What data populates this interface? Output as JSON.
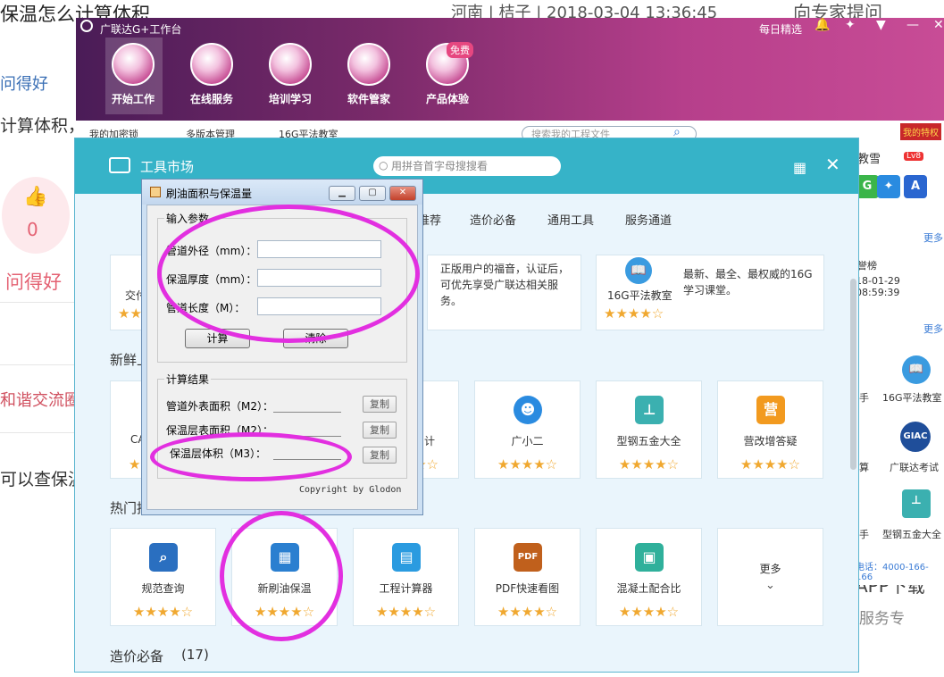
{
  "forum": {
    "title": "保温怎么计算体积",
    "meta": "河南 | 桔子 | 2018-03-04 13:36:45",
    "ask_expert": "向专家提问",
    "good_question_1": "问得好",
    "calc_volume": "计算体积，",
    "like_count": "0",
    "good_question_2": "问得好",
    "harmony_link": "和谐交流圈",
    "can_query": "可以查保温",
    "app_download": "APP下载",
    "service": "服务专"
  },
  "workbench": {
    "title": "广联达G+工作台",
    "daily_pick": "每日精选",
    "nav": [
      {
        "label": "开始工作"
      },
      {
        "label": "在线服务"
      },
      {
        "label": "培训学习"
      },
      {
        "label": "软件管家"
      },
      {
        "label": "产品体验"
      }
    ],
    "free_badge": "免费",
    "search_placeholder": "搜索我的工程文件",
    "quick_links": [
      "我的加密锁",
      "多版本管理",
      "16G平法教室"
    ]
  },
  "side": {
    "tag": "我的特权",
    "user": "教雪",
    "level": "Lv8",
    "more": "更多",
    "rank": "誉榜",
    "rank_time": "18-01-29 08:59:39",
    "items": [
      "手",
      "16G平法教室",
      "算",
      "广联达考试",
      "手",
      "型钢五金大全"
    ],
    "phone": "电话：4000-166-166"
  },
  "market": {
    "title": "工具市场",
    "search_placeholder": "用拼音首字母搜搜看",
    "tabs": [
      "推荐",
      "造价必备",
      "通用工具",
      "服务通道"
    ],
    "top_cards": [
      {
        "name": "交付",
        "desc": ""
      },
      {
        "name": "",
        "desc": "正版用户的福音，认证后，可优先享受广联达相关服务。"
      },
      {
        "name": "16G平法教室",
        "desc": "最新、最全、最权威的16G学习课堂。"
      }
    ],
    "fresh_title": "新鲜上架",
    "fresh_cards": [
      {
        "name": "CA",
        "rating": "★★★★☆"
      },
      {
        "name": "计",
        "rating": "★★★★☆"
      },
      {
        "name": "广小二",
        "rating": "★★★★☆"
      },
      {
        "name": "型钢五金大全",
        "rating": "★★★★☆"
      },
      {
        "name": "营改增答疑",
        "rating": "★★★★☆"
      }
    ],
    "hot_title": "热门推荐",
    "hot_cards": [
      {
        "name": "规范查询",
        "rating": "★★★★☆"
      },
      {
        "name": "新刷油保温",
        "rating": "★★★★☆"
      },
      {
        "name": "工程计算器",
        "rating": "★★★★☆"
      },
      {
        "name": "PDF快速看图",
        "rating": "★★★★☆"
      },
      {
        "name": "混凝土配合比",
        "rating": "★★★★☆"
      }
    ],
    "more": "更多",
    "cost_title": "造价必备",
    "cost_count": "(17)"
  },
  "dialog": {
    "title": "刷油面积与保温量",
    "input_group": "输入参数",
    "fields": [
      {
        "label": "管道外径（mm）：",
        "value": ""
      },
      {
        "label": "保温厚度（mm）：",
        "value": ""
      },
      {
        "label": "管道长度（M）：",
        "value": ""
      }
    ],
    "calc_button": "计算",
    "clear_button": "清除",
    "result_group": "计算结果",
    "results": [
      {
        "label": "管道外表面积（M2）：",
        "copy": "复制"
      },
      {
        "label": "保温层表面积（M2）：",
        "copy": "复制"
      },
      {
        "label": "保温层体积（M3）：",
        "copy": "复制"
      }
    ],
    "copyright": "Copyright by Glodon"
  }
}
